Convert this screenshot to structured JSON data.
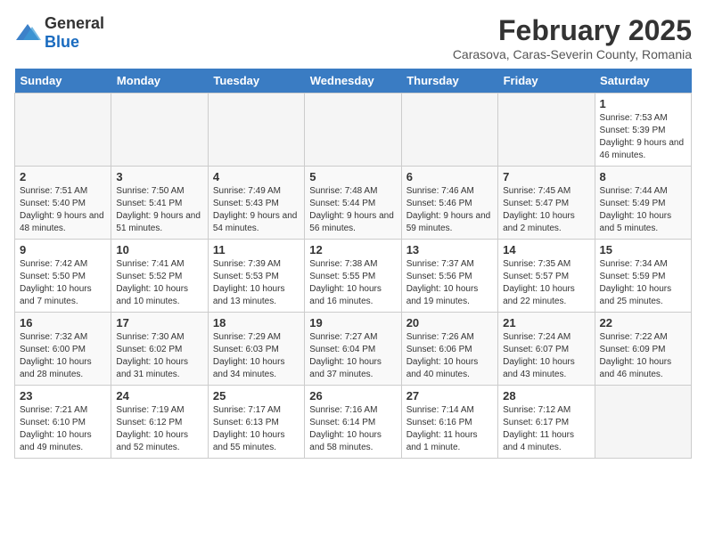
{
  "header": {
    "logo_general": "General",
    "logo_blue": "Blue",
    "month_title": "February 2025",
    "subtitle": "Carasova, Caras-Severin County, Romania"
  },
  "weekdays": [
    "Sunday",
    "Monday",
    "Tuesday",
    "Wednesday",
    "Thursday",
    "Friday",
    "Saturday"
  ],
  "weeks": [
    [
      {
        "day": "",
        "info": ""
      },
      {
        "day": "",
        "info": ""
      },
      {
        "day": "",
        "info": ""
      },
      {
        "day": "",
        "info": ""
      },
      {
        "day": "",
        "info": ""
      },
      {
        "day": "",
        "info": ""
      },
      {
        "day": "1",
        "info": "Sunrise: 7:53 AM\nSunset: 5:39 PM\nDaylight: 9 hours and 46 minutes."
      }
    ],
    [
      {
        "day": "2",
        "info": "Sunrise: 7:51 AM\nSunset: 5:40 PM\nDaylight: 9 hours and 48 minutes."
      },
      {
        "day": "3",
        "info": "Sunrise: 7:50 AM\nSunset: 5:41 PM\nDaylight: 9 hours and 51 minutes."
      },
      {
        "day": "4",
        "info": "Sunrise: 7:49 AM\nSunset: 5:43 PM\nDaylight: 9 hours and 54 minutes."
      },
      {
        "day": "5",
        "info": "Sunrise: 7:48 AM\nSunset: 5:44 PM\nDaylight: 9 hours and 56 minutes."
      },
      {
        "day": "6",
        "info": "Sunrise: 7:46 AM\nSunset: 5:46 PM\nDaylight: 9 hours and 59 minutes."
      },
      {
        "day": "7",
        "info": "Sunrise: 7:45 AM\nSunset: 5:47 PM\nDaylight: 10 hours and 2 minutes."
      },
      {
        "day": "8",
        "info": "Sunrise: 7:44 AM\nSunset: 5:49 PM\nDaylight: 10 hours and 5 minutes."
      }
    ],
    [
      {
        "day": "9",
        "info": "Sunrise: 7:42 AM\nSunset: 5:50 PM\nDaylight: 10 hours and 7 minutes."
      },
      {
        "day": "10",
        "info": "Sunrise: 7:41 AM\nSunset: 5:52 PM\nDaylight: 10 hours and 10 minutes."
      },
      {
        "day": "11",
        "info": "Sunrise: 7:39 AM\nSunset: 5:53 PM\nDaylight: 10 hours and 13 minutes."
      },
      {
        "day": "12",
        "info": "Sunrise: 7:38 AM\nSunset: 5:55 PM\nDaylight: 10 hours and 16 minutes."
      },
      {
        "day": "13",
        "info": "Sunrise: 7:37 AM\nSunset: 5:56 PM\nDaylight: 10 hours and 19 minutes."
      },
      {
        "day": "14",
        "info": "Sunrise: 7:35 AM\nSunset: 5:57 PM\nDaylight: 10 hours and 22 minutes."
      },
      {
        "day": "15",
        "info": "Sunrise: 7:34 AM\nSunset: 5:59 PM\nDaylight: 10 hours and 25 minutes."
      }
    ],
    [
      {
        "day": "16",
        "info": "Sunrise: 7:32 AM\nSunset: 6:00 PM\nDaylight: 10 hours and 28 minutes."
      },
      {
        "day": "17",
        "info": "Sunrise: 7:30 AM\nSunset: 6:02 PM\nDaylight: 10 hours and 31 minutes."
      },
      {
        "day": "18",
        "info": "Sunrise: 7:29 AM\nSunset: 6:03 PM\nDaylight: 10 hours and 34 minutes."
      },
      {
        "day": "19",
        "info": "Sunrise: 7:27 AM\nSunset: 6:04 PM\nDaylight: 10 hours and 37 minutes."
      },
      {
        "day": "20",
        "info": "Sunrise: 7:26 AM\nSunset: 6:06 PM\nDaylight: 10 hours and 40 minutes."
      },
      {
        "day": "21",
        "info": "Sunrise: 7:24 AM\nSunset: 6:07 PM\nDaylight: 10 hours and 43 minutes."
      },
      {
        "day": "22",
        "info": "Sunrise: 7:22 AM\nSunset: 6:09 PM\nDaylight: 10 hours and 46 minutes."
      }
    ],
    [
      {
        "day": "23",
        "info": "Sunrise: 7:21 AM\nSunset: 6:10 PM\nDaylight: 10 hours and 49 minutes."
      },
      {
        "day": "24",
        "info": "Sunrise: 7:19 AM\nSunset: 6:12 PM\nDaylight: 10 hours and 52 minutes."
      },
      {
        "day": "25",
        "info": "Sunrise: 7:17 AM\nSunset: 6:13 PM\nDaylight: 10 hours and 55 minutes."
      },
      {
        "day": "26",
        "info": "Sunrise: 7:16 AM\nSunset: 6:14 PM\nDaylight: 10 hours and 58 minutes."
      },
      {
        "day": "27",
        "info": "Sunrise: 7:14 AM\nSunset: 6:16 PM\nDaylight: 11 hours and 1 minute."
      },
      {
        "day": "28",
        "info": "Sunrise: 7:12 AM\nSunset: 6:17 PM\nDaylight: 11 hours and 4 minutes."
      },
      {
        "day": "",
        "info": ""
      }
    ]
  ]
}
